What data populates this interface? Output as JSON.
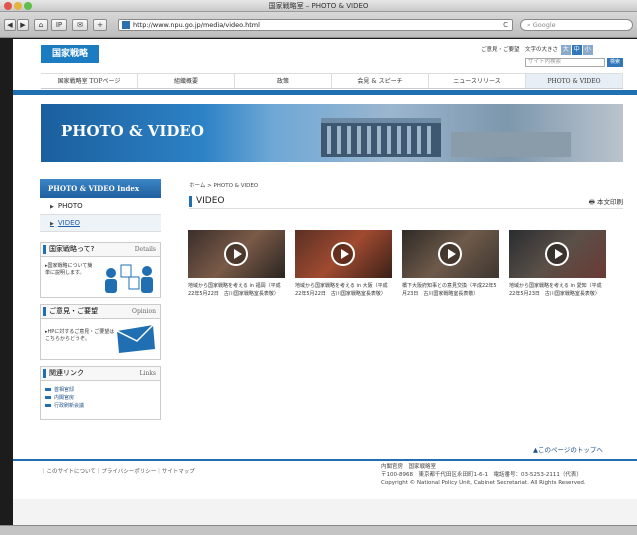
{
  "window": {
    "title": "国家戦略室 – PHOTO & VIDEO"
  },
  "browser": {
    "url": "http://www.npu.go.jp/media/video.html",
    "search_placeholder": "Google",
    "reload_icon": "C",
    "buttons": [
      "◀",
      "▶",
      "⌂",
      "IP",
      "✉",
      "+"
    ]
  },
  "header": {
    "logo_text": "国家戦略",
    "util_links": "ご意見・ご要望　文字の大きさ",
    "font_sizes": [
      "大",
      "中",
      "小"
    ],
    "site_search_placeholder": "サイト内検索",
    "search_button": "検索"
  },
  "global_nav": [
    "国家戦略室 TOPページ",
    "組織概要",
    "政策",
    "会見 & スピーチ",
    "ニュースリリース",
    "PHOTO & VIDEO"
  ],
  "hero": {
    "title": "PHOTO & VIDEO"
  },
  "sidebar": {
    "index_title": "PHOTO & VIDEO Index",
    "items": [
      {
        "label": "PHOTO"
      },
      {
        "label": "VIDEO"
      }
    ],
    "box_about": {
      "title": "国家戦略って?",
      "en": "Details",
      "text": "▸国家戦略について簡単に説明します。"
    },
    "box_opinion": {
      "title": "ご意見・ご要望",
      "en": "Opinion",
      "text": "▸HPに対するご意見・ご要望はこちらからどうぞ。"
    },
    "box_links": {
      "title": "関連リンク",
      "en": "Links",
      "items": [
        "首相官邸",
        "内閣官房",
        "行政刷新会議"
      ]
    }
  },
  "main": {
    "breadcrumb": "ホーム > PHOTO & VIDEO",
    "section_title": "VIDEO",
    "print_label": "本文印刷",
    "videos": [
      {
        "caption": "地域から国家戦略を考える in 福岡（平成22年5月22日　古川国家戦略室長表敬）"
      },
      {
        "caption": "地域から国家戦略を考える in 大阪（平成22年5月22日　古川国家戦略室長表敬）"
      },
      {
        "caption": "橋下大阪府知事との意見交換（平成22年5月23日　古川国家戦略室長表敬）"
      },
      {
        "caption": "地域から国家戦略を考える in 愛知（平成22年5月23日　古川国家戦略室長表敬）"
      }
    ],
    "to_top": "▲このページのトップへ"
  },
  "footer": {
    "nav": "｜このサイトについて｜プライバシーポリシー｜サイトマップ",
    "org": "内閣官房　国家戦略室",
    "address": "〒100-8968　東京都千代田区永田町1-6-1　電話番号：03-5253-2111（代表）",
    "copyright": "Copyright © National Policy Unit, Cabinet Secretariat. All Rights Reserved."
  }
}
